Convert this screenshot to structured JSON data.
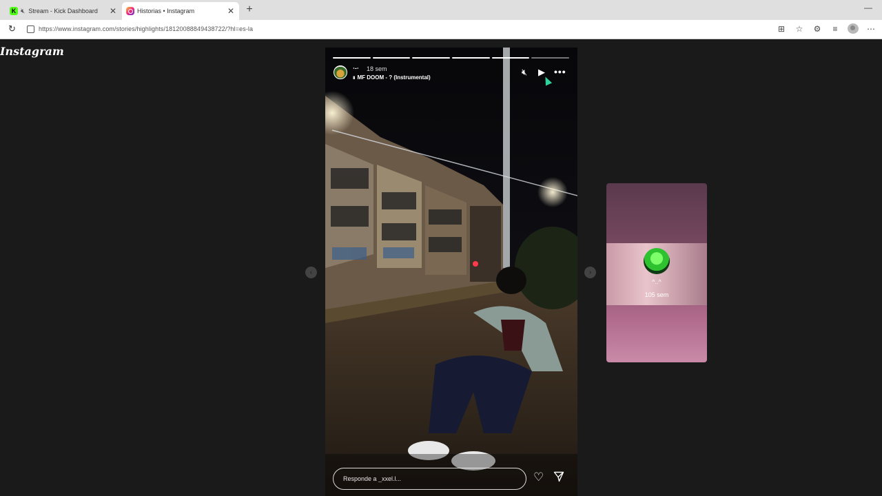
{
  "browser": {
    "tabs": [
      {
        "title": "Stream - Kick Dashboard",
        "favicon": "kick-icon",
        "muted": true,
        "active": false
      },
      {
        "title": "Historias • Instagram",
        "favicon": "instagram-icon",
        "muted": false,
        "active": true
      }
    ],
    "url": "https://www.instagram.com/stories/highlights/18120088849438722/?hl=es-la"
  },
  "instagram": {
    "logo": "Instagram",
    "story": {
      "username": "⋅-⋅",
      "time": "18 sem",
      "music": "MF DOOM - ? (Instrumental)",
      "reply_placeholder": "Responde a _xxel.l...",
      "progress_segments": 6,
      "progress_completed": 5
    },
    "next_preview": {
      "username": "^..^",
      "time": "105 sem"
    }
  },
  "colors": {
    "page_bg": "#1a1a1a",
    "kick_green": "#53fc18",
    "cursor": "#2fd39a"
  }
}
